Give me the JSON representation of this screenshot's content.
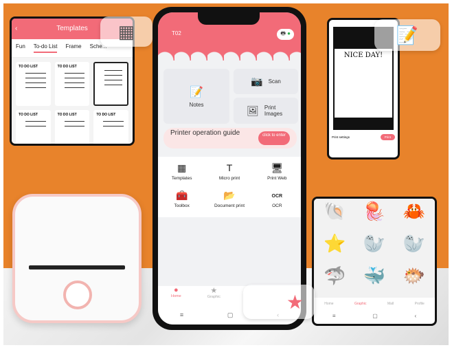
{
  "templates_screen": {
    "title": "Templates",
    "tabs": [
      "Fun",
      "To-do List",
      "Frame",
      "Sche..."
    ],
    "active_tab": "To-do List",
    "thumb_labels": [
      "TO DO LIST",
      "TO DO LIST",
      "",
      "TO DO LIST",
      "TO DO LIST",
      "TO DO LIST"
    ]
  },
  "phone": {
    "device": "T02",
    "tiles": {
      "notes": "Notes",
      "scan": "Scan",
      "print_images": "Print Images"
    },
    "guide": {
      "text": "Printer operation guide",
      "button": "click to enter"
    },
    "functions": [
      {
        "label": "Templates",
        "icon": "▦"
      },
      {
        "label": "Micro print",
        "icon": "T"
      },
      {
        "label": "Print Web",
        "icon": "🖥"
      },
      {
        "label": "Toolbox",
        "icon": "🧰"
      },
      {
        "label": "Document print",
        "icon": "📂"
      },
      {
        "label": "OCR",
        "icon": "OCR"
      }
    ],
    "nav": [
      "Home",
      "Graphic"
    ]
  },
  "nice_screen": {
    "text": "NICE DAY!",
    "print_settings": "Print settings",
    "print_button": "Print"
  },
  "ocean_screen": {
    "nav": [
      "Home",
      "Graphic",
      "Mall",
      "Profile"
    ]
  },
  "colors": {
    "accent": "#f26b78",
    "background": "#e8832b"
  }
}
